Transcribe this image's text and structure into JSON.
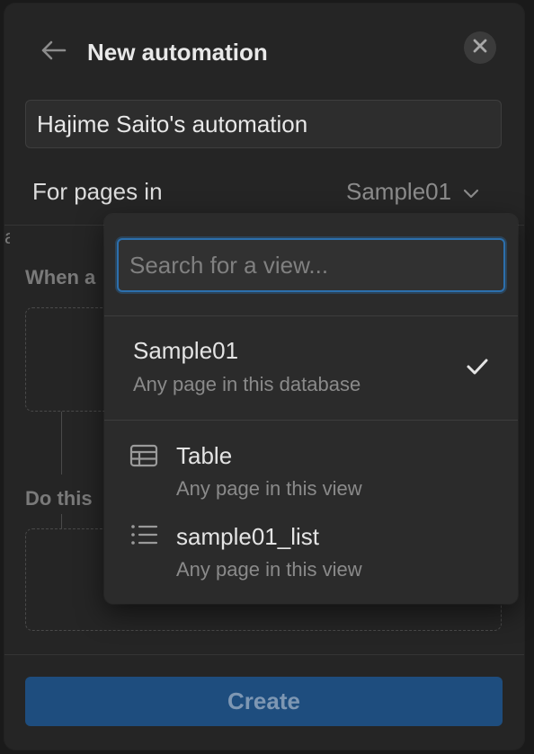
{
  "header": {
    "title": "New automation",
    "back_icon": "arrow-left-icon",
    "close_icon": "close-icon"
  },
  "name_input": {
    "value": "Hajime Saito's automation"
  },
  "scope": {
    "label": "For pages in",
    "selected": "Sample01",
    "chevron_icon": "chevron-down-icon"
  },
  "sections": {
    "trigger_label": "When a",
    "action_label": "Do this"
  },
  "dropdown": {
    "search_placeholder": "Search for a view...",
    "database_option": {
      "title": "Sample01",
      "subtitle": "Any page in this database",
      "selected": true,
      "check_icon": "checkmark-icon"
    },
    "views": [
      {
        "title": "Table",
        "subtitle": "Any page in this view",
        "icon": "table-icon"
      },
      {
        "title": "sample01_list",
        "subtitle": "Any page in this view",
        "icon": "list-icon"
      }
    ]
  },
  "footer": {
    "create_label": "Create"
  },
  "colors": {
    "panel_bg": "#252525",
    "dropdown_bg": "#2b2b2b",
    "accent_blue": "#2c6fad",
    "create_button_bg": "#1e4d7e",
    "text_primary": "#e8e8e8",
    "text_muted": "#8a8a8a"
  }
}
